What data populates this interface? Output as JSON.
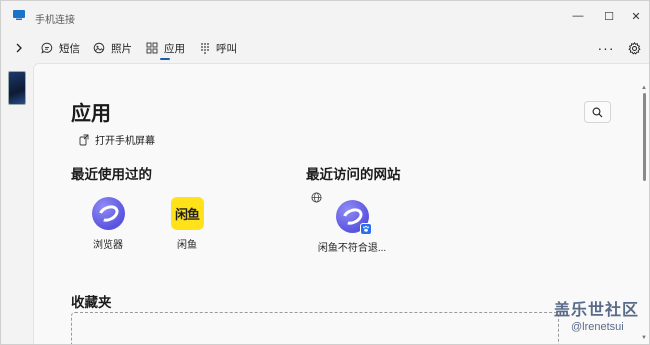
{
  "window": {
    "title": "手机连接",
    "minimize_glyph": "—",
    "maximize_glyph": "☐",
    "close_glyph": "✕"
  },
  "nav": {
    "tabs": [
      {
        "label": "短信",
        "icon": "chat-icon"
      },
      {
        "label": "照片",
        "icon": "photo-icon"
      },
      {
        "label": "应用",
        "icon": "apps-icon",
        "selected": true
      },
      {
        "label": "呼叫",
        "icon": "dialpad-icon"
      }
    ],
    "more_glyph": "···"
  },
  "page": {
    "title": "应用",
    "open_screen_label": "打开手机屏幕",
    "recent_apps_title": "最近使用过的",
    "recent_sites_title": "最近访问的网站",
    "favorites_title": "收藏夹",
    "recent_apps": [
      {
        "label": "浏览器",
        "icon": "browser-icon"
      },
      {
        "label": "闲鱼",
        "icon": "xianyu-icon",
        "icon_text": "闲鱼"
      }
    ],
    "recent_sites": [
      {
        "label": "闲鱼不符合退...",
        "icon": "browser-icon"
      }
    ]
  },
  "watermark": {
    "line1": "盖乐世社区",
    "line2": "@lrenetsui"
  },
  "colors": {
    "accent": "#1f5fa8",
    "xianyu_yellow": "#ffe21a",
    "browser_purple": "#5a53e0"
  }
}
